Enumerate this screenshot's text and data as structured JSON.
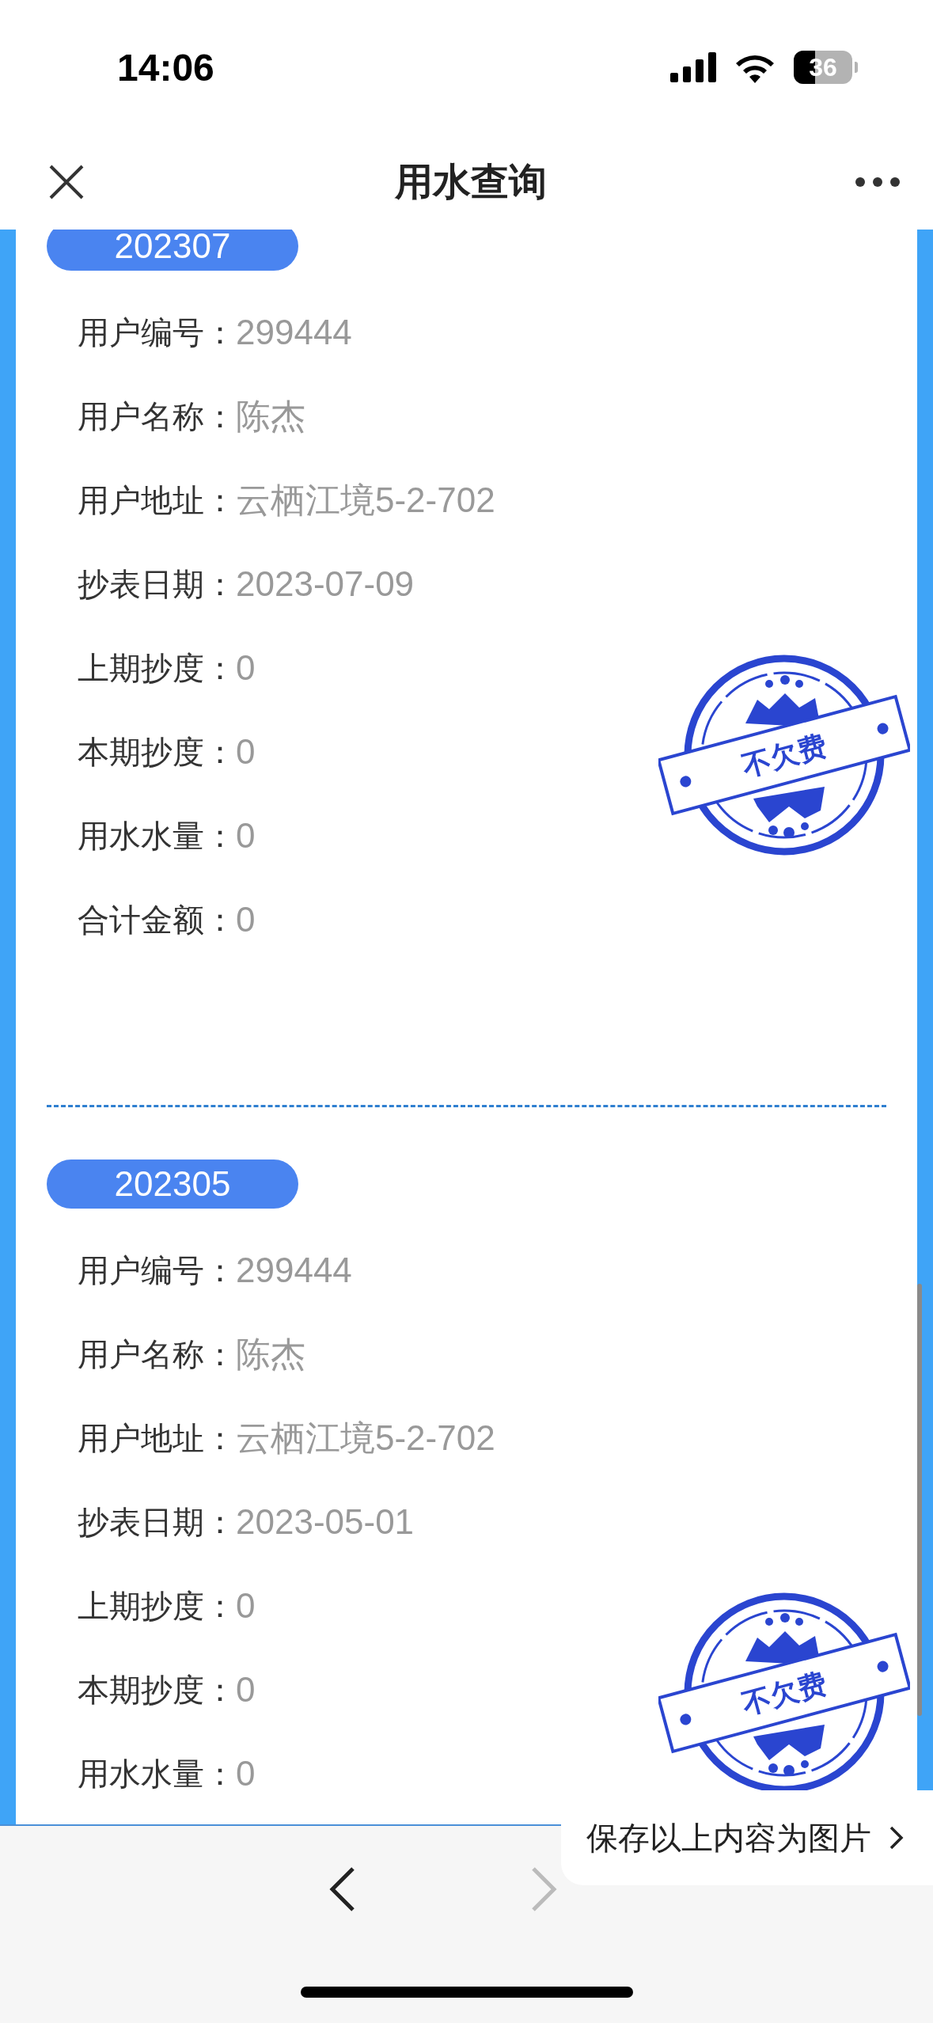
{
  "status_bar": {
    "time": "14:06",
    "battery": "36"
  },
  "nav_bar": {
    "title": "用水查询"
  },
  "records": [
    {
      "period": "202307",
      "stamp": "不欠费",
      "fields": [
        {
          "label": "用户编号：",
          "value": "299444"
        },
        {
          "label": "用户名称：",
          "value": "陈杰"
        },
        {
          "label": "用户地址：",
          "value": "云栖江境5-2-702"
        },
        {
          "label": "抄表日期：",
          "value": "2023-07-09"
        },
        {
          "label": "上期抄度：",
          "value": "0"
        },
        {
          "label": "本期抄度：",
          "value": "0"
        },
        {
          "label": "用水水量：",
          "value": "0"
        },
        {
          "label": "合计金额：",
          "value": "0"
        }
      ]
    },
    {
      "period": "202305",
      "stamp": "不欠费",
      "fields": [
        {
          "label": "用户编号：",
          "value": "299444"
        },
        {
          "label": "用户名称：",
          "value": "陈杰"
        },
        {
          "label": "用户地址：",
          "value": "云栖江境5-2-702"
        },
        {
          "label": "抄表日期：",
          "value": "2023-05-01"
        },
        {
          "label": "上期抄度：",
          "value": "0"
        },
        {
          "label": "本期抄度：",
          "value": "0"
        },
        {
          "label": "用水水量：",
          "value": "0"
        }
      ]
    }
  ],
  "toolbar": {
    "back_disabled": false,
    "forward_disabled": true
  },
  "save_tip": "保存以上内容为图片"
}
